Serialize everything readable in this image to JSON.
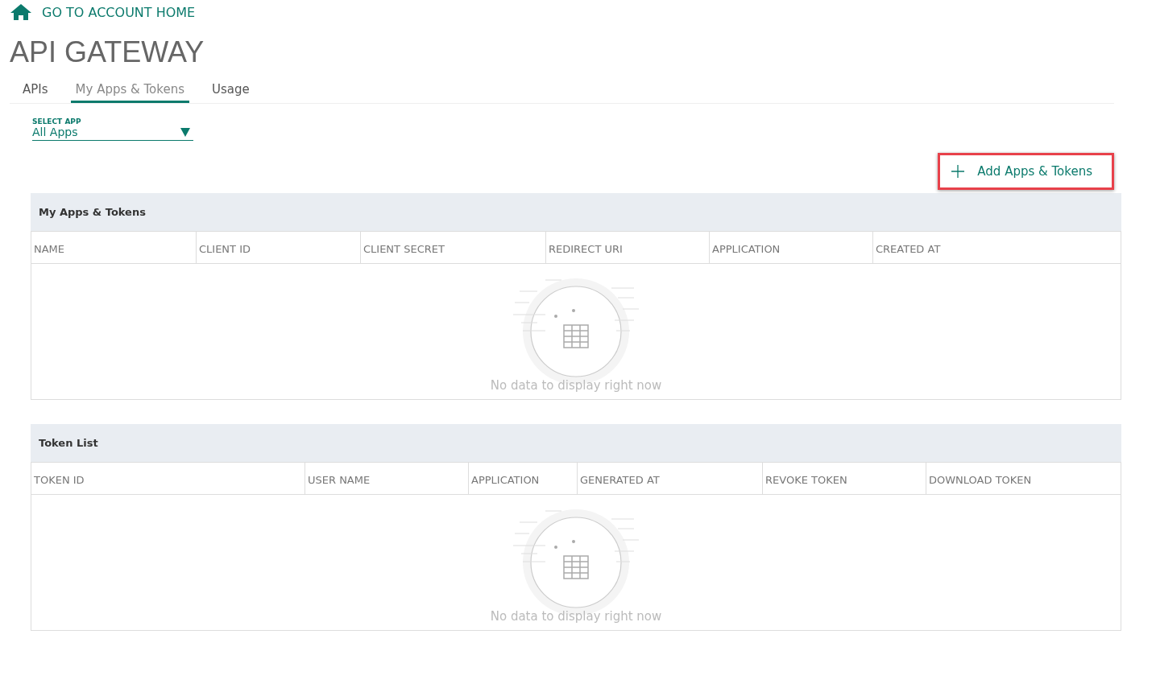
{
  "home_link": "GO TO ACCOUNT HOME",
  "title": "API GATEWAY",
  "tabs": [
    {
      "label": "APIs",
      "selected": false
    },
    {
      "label": "My Apps & Tokens",
      "selected": true
    },
    {
      "label": "Usage",
      "selected": false
    }
  ],
  "select_app": {
    "label": "SELECT APP",
    "value": "All Apps"
  },
  "add_button": "Add Apps & Tokens",
  "panels": [
    {
      "title": "My Apps & Tokens",
      "columns": [
        "NAME",
        "CLIENT ID",
        "CLIENT SECRET",
        "REDIRECT URI",
        "APPLICATION",
        "CREATED AT"
      ],
      "empty_text": "No data to display right now"
    },
    {
      "title": "Token List",
      "columns": [
        "TOKEN ID",
        "USER NAME",
        "APPLICATION",
        "GENERATED AT",
        "REVOKE TOKEN",
        "DOWNLOAD TOKEN"
      ],
      "empty_text": "No data to display right now"
    }
  ]
}
